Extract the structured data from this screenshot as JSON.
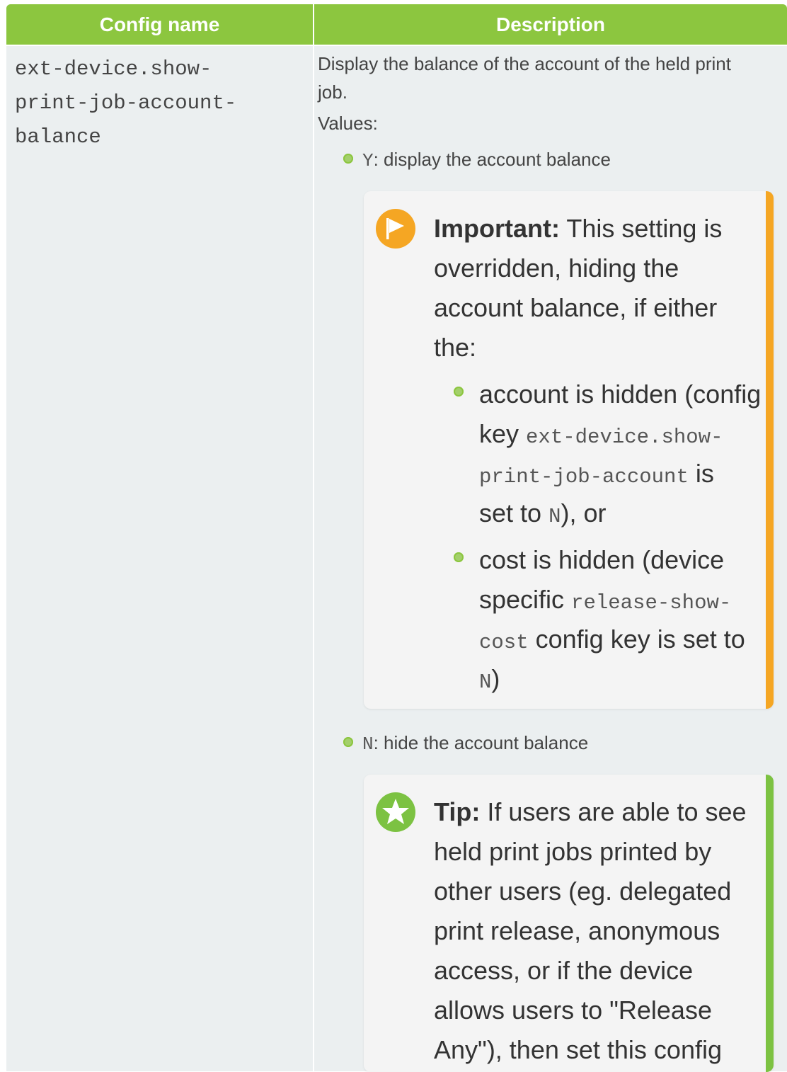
{
  "table": {
    "headers": {
      "config_name": "Config name",
      "description": "Description"
    },
    "row": {
      "config_name_lines": [
        "ext-device.show-",
        "print-job-account-",
        "balance"
      ],
      "description": {
        "intro_line1": "Display the balance of the account of the held print",
        "intro_line2": "job.",
        "values_label": "Values:",
        "value_y": {
          "code": "Y",
          "text": ": display the account balance"
        },
        "important": {
          "icon": "flag-icon",
          "color": "#f5a623",
          "label": "Important:",
          "l1": " This setting is",
          "l2": "overridden, hiding the",
          "l3": "account balance, if either",
          "l4": "the:",
          "b1_l1": "account is hidden (config",
          "b1_l2a": "key ",
          "b1_l2b": "ext-device.show-",
          "b1_l3a": "print-job-account",
          "b1_l3b": " is",
          "b1_l4a": "set to ",
          "b1_l4b": "N",
          "b1_l4c": "), or",
          "b2_l1": "cost is hidden (device",
          "b2_l2a": "specific ",
          "b2_l2b": "release-show-",
          "b2_l3a": "cost",
          "b2_l3b": " config key is set to",
          "b2_l4a": "N",
          "b2_l4b": ")"
        },
        "value_n": {
          "code": "N",
          "text": ": hide the account balance"
        },
        "tip": {
          "icon": "star-icon",
          "color": "#7cc242",
          "label": "Tip:",
          "l1": " If users are able to see",
          "l2": "held print jobs printed by",
          "l3": "other users (eg. delegated",
          "l4": "print release, anonymous",
          "l5": "access, or if the device",
          "l6": "allows users to \"Release",
          "l7": "Any\"), then set this config"
        }
      }
    }
  },
  "colors": {
    "header_green": "#8cc63f",
    "cell_bg": "#ebeff0",
    "note_bg": "#f4f4f4"
  }
}
